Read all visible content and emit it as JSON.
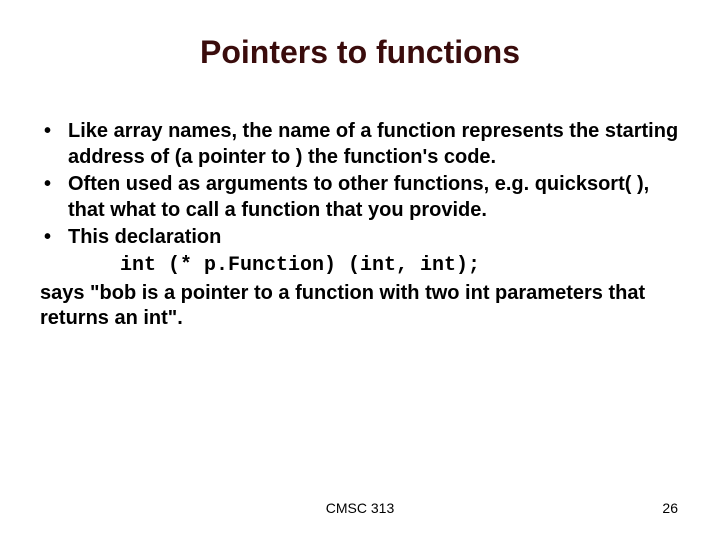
{
  "title": "Pointers to functions",
  "bullets": {
    "b1": "Like array names, the name of a function represents the starting address of (a pointer to ) the function's code.",
    "b2": "Often used as arguments to other functions, e.g. quicksort( ), that what to call a function that you provide.",
    "b3": "This declaration"
  },
  "code": "int (* p.Function) (int, int);",
  "closing": "says \"bob is a pointer to a function with two int parameters that returns an int\".",
  "footer": {
    "course": "CMSC 313",
    "page": "26"
  }
}
